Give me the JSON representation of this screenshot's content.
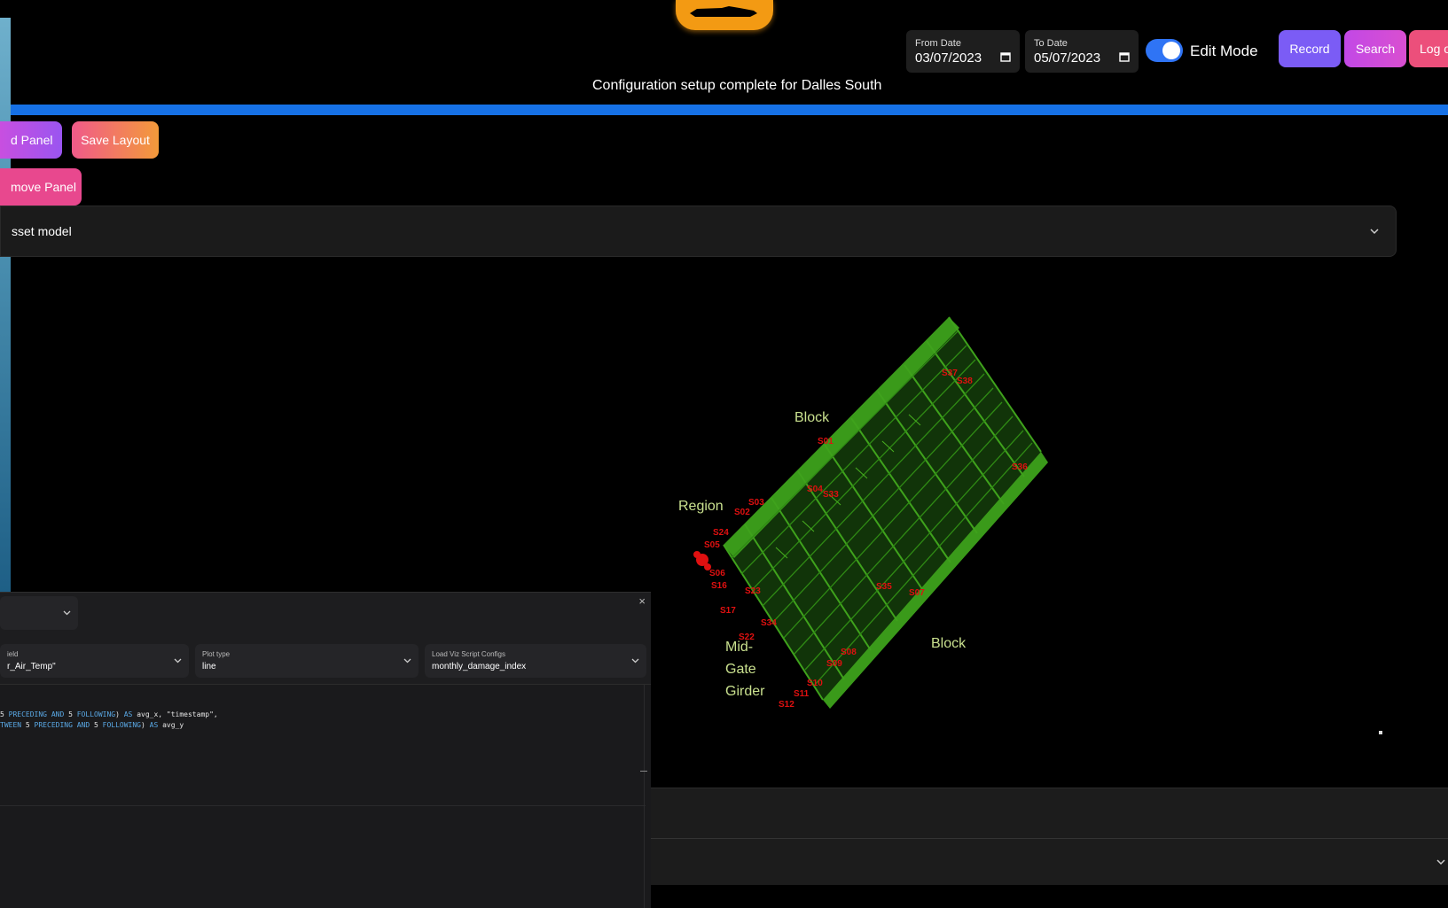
{
  "header": {
    "from_date_label": "From Date",
    "from_date_value": "03/07/2023",
    "to_date_label": "To Date",
    "to_date_value": "05/07/2023",
    "edit_mode_label": "Edit Mode",
    "edit_mode_on": true,
    "record_label": "Record",
    "search_label": "Search",
    "logout_label": "Log o",
    "status_message": "Configuration setup complete for Dalles South"
  },
  "toolbar": {
    "add_panel_label": "d Panel",
    "save_layout_label": "Save Layout",
    "remove_panel_label": "move Panel"
  },
  "accordion": {
    "title": "sset model"
  },
  "model": {
    "labels": {
      "block_top_line2": "Block",
      "region": "Region",
      "mid_gate_girder_1": "Mid-",
      "mid_gate_girder_2": "Gate",
      "mid_gate_girder_3": "Girder",
      "block_right": "Block"
    },
    "sensors": [
      "S37",
      "S38",
      "S01",
      "S36",
      "S04",
      "S33",
      "S03",
      "S02",
      "S24",
      "S05",
      "S06",
      "S16",
      "S23",
      "S35",
      "S07",
      "S08",
      "S09",
      "S10",
      "S11",
      "S12",
      "S17",
      "S34",
      "S22"
    ]
  },
  "panel": {
    "close_label": "×",
    "field_label": "ield",
    "field_value": "r_Air_Temp\"",
    "plot_type_label": "Plot type",
    "plot_type_value": "line",
    "load_viz_label": "Load Viz Script Configs",
    "load_viz_value": "monthly_damage_index",
    "code_line1": {
      "a": "5 ",
      "b": "PRECEDING",
      "c": " ",
      "d": "AND",
      "e": " 5 ",
      "f": "FOLLOWING",
      "g": ") ",
      "h": "AS",
      "i": " avg_x, \"timestamp\","
    },
    "code_line2": {
      "a": "TWEEN",
      "b": " 5 ",
      "c": "PRECEDING",
      "d": " ",
      "e": "AND",
      "f": " 5 ",
      "g": "FOLLOWING",
      "h": ") ",
      "i": "AS",
      "j": " avg_y"
    }
  },
  "colors": {
    "accent_blue": "#1671e6",
    "record_purple": "#7b5cf5",
    "search_magenta": "#d24ae0",
    "logout_pink": "#ec4f7b",
    "model_green": "#2c8a14",
    "sensor_red": "#e01010",
    "logo_orange": "#f39a13"
  }
}
